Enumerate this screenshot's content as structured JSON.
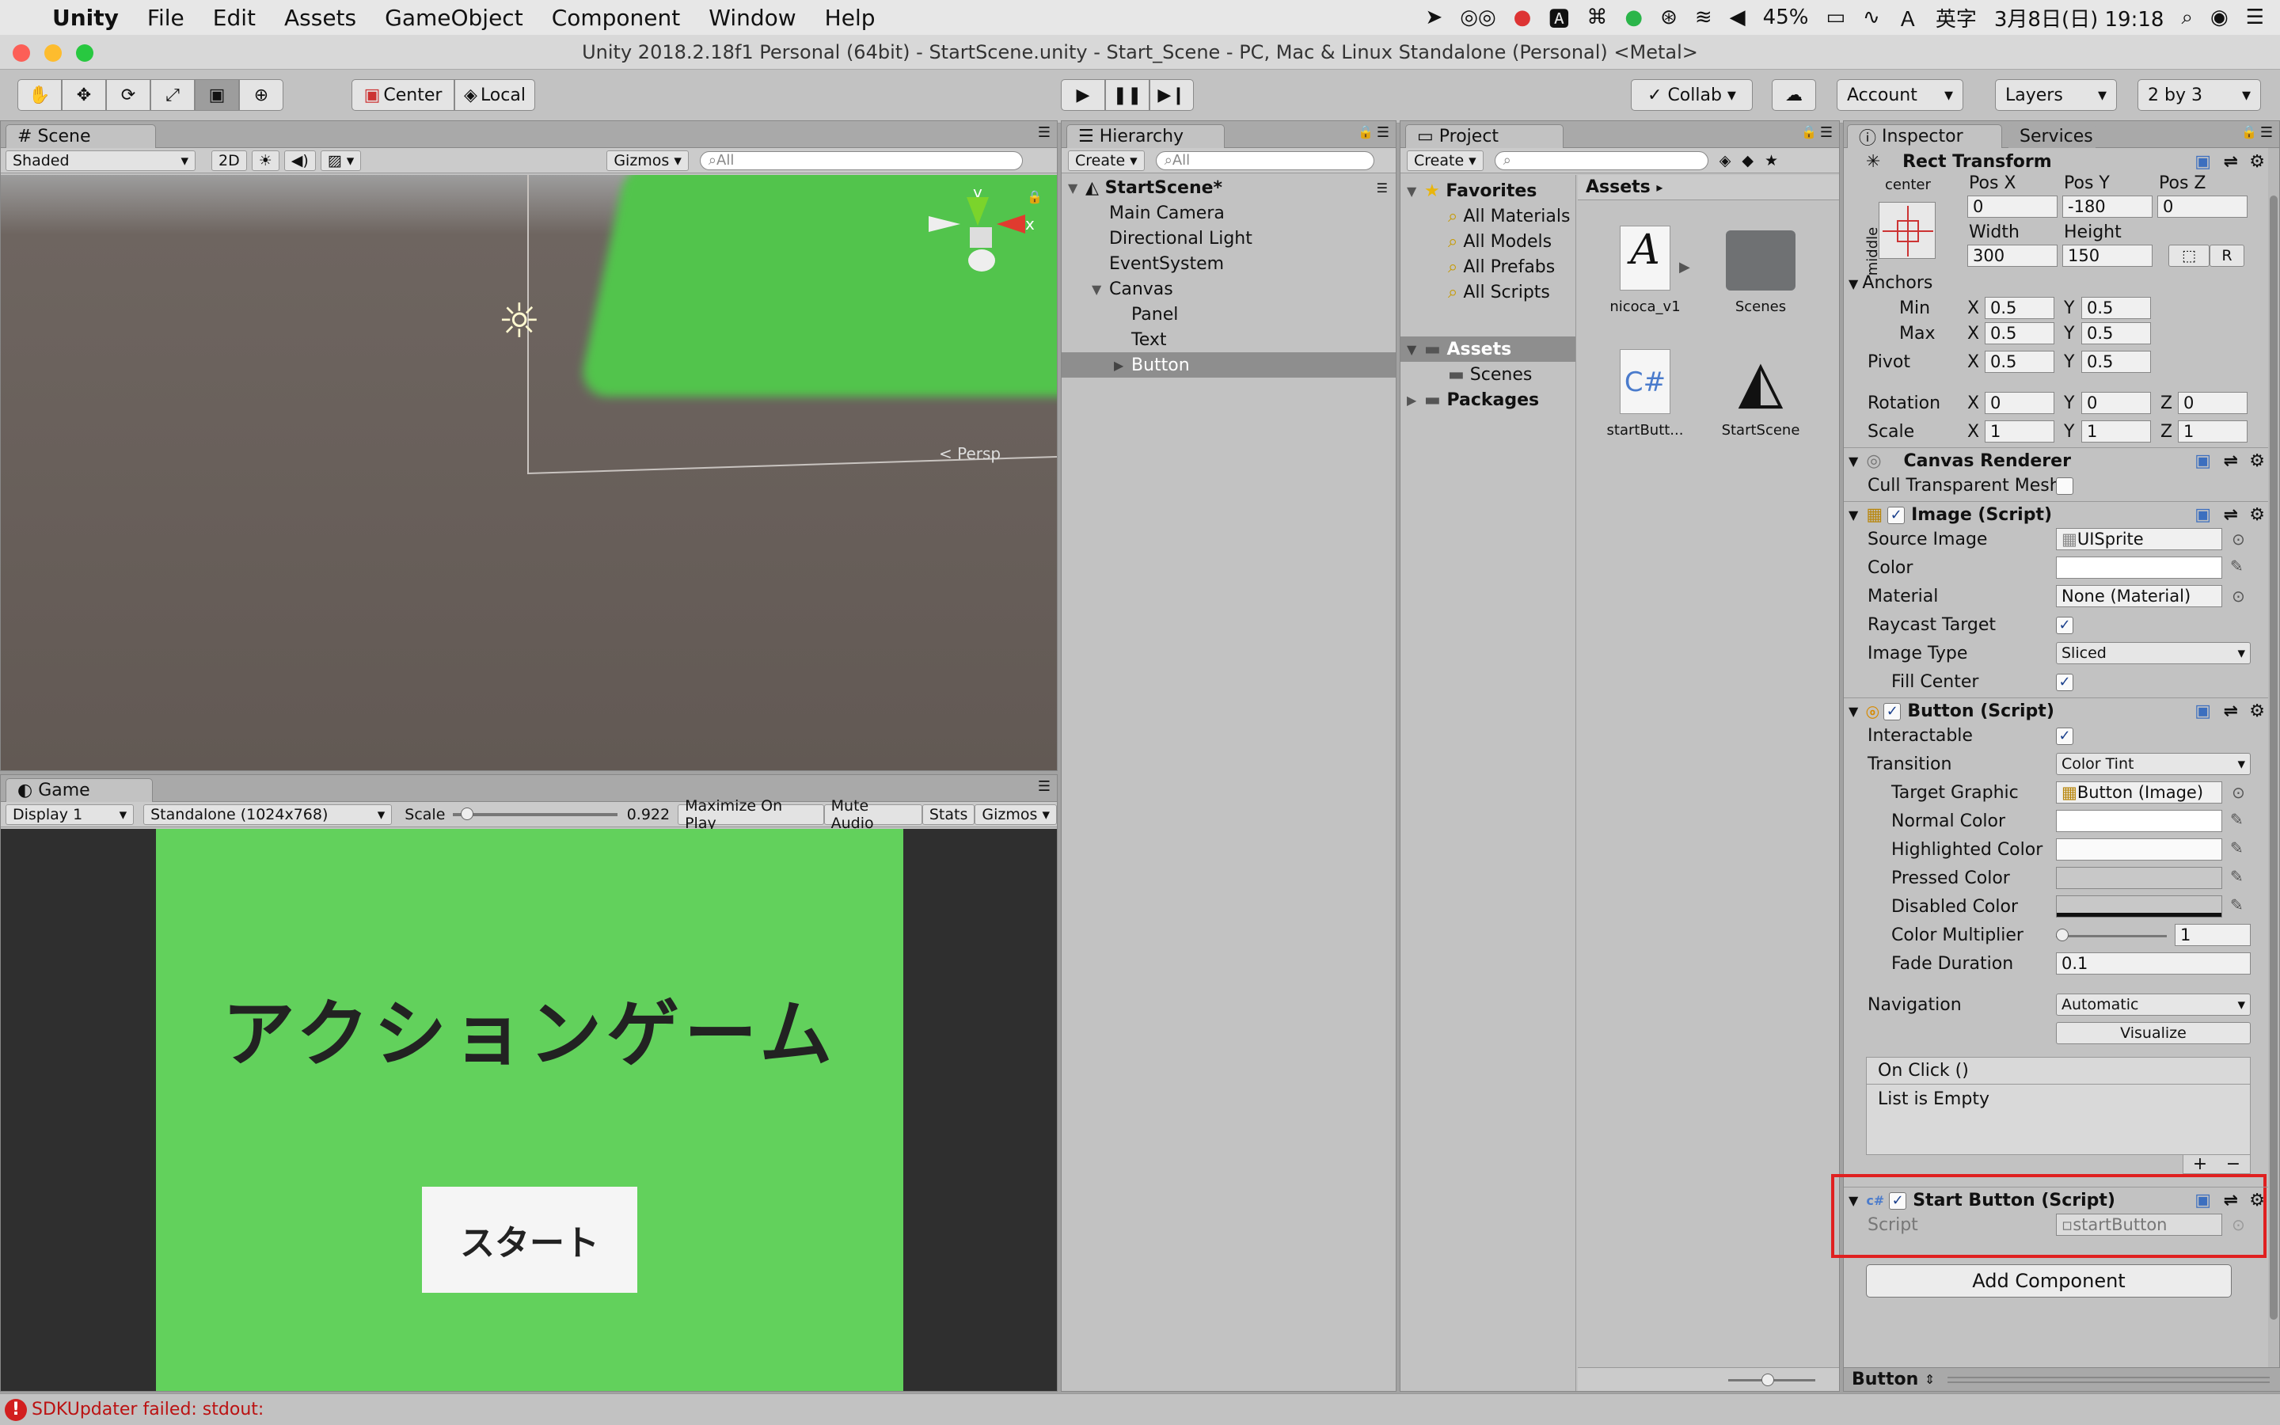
{
  "menubar": {
    "app": "Unity",
    "items": [
      "File",
      "Edit",
      "Assets",
      "GameObject",
      "Component",
      "Window",
      "Help"
    ],
    "battery": "45%",
    "input_mode": "英字",
    "datetime": "3月8日(日) 19:18"
  },
  "window": {
    "title": "Unity 2018.2.18f1 Personal (64bit) - StartScene.unity - Start_Scene - PC, Mac & Linux Standalone (Personal) <Metal>"
  },
  "toolbar": {
    "pivot": "Center",
    "space": "Local",
    "collab": "Collab",
    "account": "Account",
    "layers": "Layers",
    "layout": "2 by 3"
  },
  "scene": {
    "tab": "Scene",
    "shading": "Shaded",
    "mode2d": "2D",
    "gizmos": "Gizmos",
    "search_placeholder": "All",
    "persp": "< Persp",
    "axis_y": "y",
    "axis_x": "x"
  },
  "game": {
    "tab": "Game",
    "display": "Display 1",
    "resolution": "Standalone (1024x768)",
    "scale_label": "Scale",
    "scale_value": "0.922",
    "scale_fraction": 0.05,
    "maximize": "Maximize On Play",
    "mute": "Mute Audio",
    "stats": "Stats",
    "gizmos": "Gizmos",
    "title_text": "アクションゲーム",
    "button_text": "スタート"
  },
  "hierarchy": {
    "tab": "Hierarchy",
    "create": "Create",
    "search_placeholder": "All",
    "scene": "StartScene*",
    "items": [
      {
        "label": "Main Camera",
        "indent": 1
      },
      {
        "label": "Directional Light",
        "indent": 1
      },
      {
        "label": "EventSystem",
        "indent": 1
      },
      {
        "label": "Canvas",
        "indent": 1
      },
      {
        "label": "Panel",
        "indent": 2
      },
      {
        "label": "Text",
        "indent": 2
      },
      {
        "label": "Button",
        "indent": 2
      }
    ]
  },
  "project": {
    "tab": "Project",
    "create": "Create",
    "favorites": "Favorites",
    "fav_items": [
      "All Materials",
      "All Models",
      "All Prefabs",
      "All Scripts"
    ],
    "tree": [
      "Assets",
      "Scenes",
      "Packages"
    ],
    "breadcrumb": "Assets",
    "assets": [
      {
        "name": "nicoca_v1",
        "icon": "font-icon"
      },
      {
        "name": "Scenes",
        "icon": "folder-icon"
      },
      {
        "name": "startButt...",
        "icon": "csharp-script-icon"
      },
      {
        "name": "StartScene",
        "icon": "unity-scene-icon"
      }
    ]
  },
  "inspector": {
    "tab": "Inspector",
    "tab2": "Services",
    "rect_transform": {
      "title": "Rect Transform",
      "anchor_h": "center",
      "anchor_v": "middle",
      "posx_label": "Pos X",
      "posy_label": "Pos Y",
      "posz_label": "Pos Z",
      "posx": "0",
      "posy": "-180",
      "posz": "0",
      "width_label": "Width",
      "height_label": "Height",
      "width": "300",
      "height": "150",
      "r_button": "R",
      "anchors": "Anchors",
      "min": "Min",
      "max": "Max",
      "pivot": "Pivot",
      "min_x": "0.5",
      "min_y": "0.5",
      "max_x": "0.5",
      "max_y": "0.5",
      "pivot_x": "0.5",
      "pivot_y": "0.5",
      "rotation": "Rotation",
      "scale": "Scale",
      "rot_x": "0",
      "rot_y": "0",
      "rot_z": "0",
      "scale_x": "1",
      "scale_y": "1",
      "scale_z": "1",
      "x": "X",
      "y": "Y",
      "z": "Z"
    },
    "canvas_renderer": {
      "title": "Canvas Renderer",
      "cull": "Cull Transparent Mesh"
    },
    "image": {
      "title": "Image (Script)",
      "source_image_label": "Source Image",
      "source_image": "UISprite",
      "color_label": "Color",
      "material_label": "Material",
      "material": "None (Material)",
      "raycast_label": "Raycast Target",
      "image_type_label": "Image Type",
      "image_type": "Sliced",
      "fill_center_label": "Fill Center"
    },
    "button": {
      "title": "Button (Script)",
      "interactable_label": "Interactable",
      "transition_label": "Transition",
      "transition": "Color Tint",
      "target_graphic_label": "Target Graphic",
      "target_graphic": "Button (Image)",
      "normal_label": "Normal Color",
      "highlighted_label": "Highlighted Color",
      "pressed_label": "Pressed Color",
      "disabled_label": "Disabled Color",
      "multiplier_label": "Color Multiplier",
      "multiplier": "1",
      "fade_label": "Fade Duration",
      "fade": "0.1",
      "navigation_label": "Navigation",
      "navigation": "Automatic",
      "visualize": "Visualize",
      "onclick": "On Click ()",
      "list_empty": "List is Empty",
      "plus": "+",
      "minus": "−"
    },
    "start_button": {
      "title": "Start Button (Script)",
      "script_label": "Script",
      "script": "startButton"
    },
    "add_component": "Add Component",
    "footer": "Button"
  },
  "status": {
    "message": "SDKUpdater failed: stdout:"
  },
  "colors": {
    "highlight_box": "#e02020",
    "game_green": "#62d15c",
    "selection": "#8e8e8e"
  }
}
